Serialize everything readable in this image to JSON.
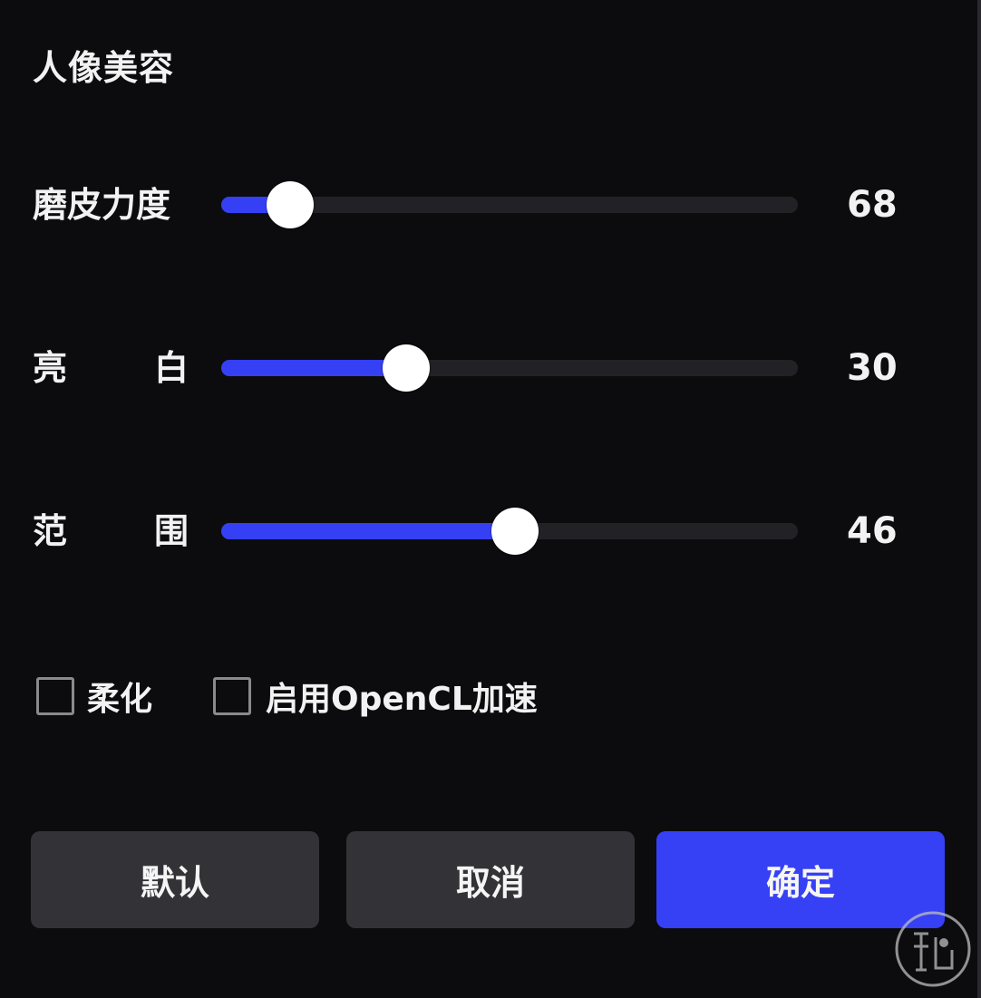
{
  "panel": {
    "title": "人像美容"
  },
  "sliders": [
    {
      "label": "磨皮力度",
      "value": "68",
      "level": 0.12
    },
    {
      "label_left": "亮",
      "label_right": "白",
      "value": "30",
      "level": 0.32
    },
    {
      "label_left": "范",
      "label_right": "围",
      "value": "46",
      "level": 0.51
    }
  ],
  "options": {
    "soften_label": "柔化",
    "soften_checked": false,
    "opencl_label": "启用OpenCL加速",
    "opencl_checked": false
  },
  "buttons": {
    "default_label": "默认",
    "cancel_label": "取消",
    "ok_label": "确定"
  },
  "colors": {
    "accent": "#3540f5",
    "background": "#0c0c0e",
    "track": "#222226",
    "button_secondary": "#333337"
  },
  "icons": {
    "watermark": "logo-watermark-icon"
  }
}
